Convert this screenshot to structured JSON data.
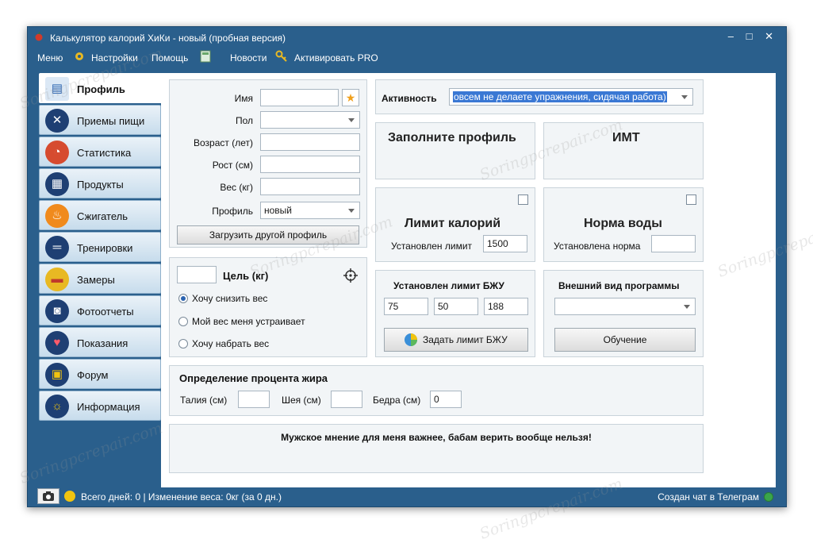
{
  "window": {
    "title": "Калькулятор калорий ХиКи - новый (пробная версия)",
    "controls": {
      "minimize": "‒",
      "maximize": "□",
      "close": "✕"
    }
  },
  "menu": {
    "menu": "Меню",
    "settings": "Настройки",
    "help": "Помощь",
    "news": "Новости",
    "activate": "Активировать PRO"
  },
  "sidebar": {
    "items": [
      {
        "label": "Профиль",
        "icon": "profile-card-icon",
        "glyph": "▤"
      },
      {
        "label": "Приемы пищи",
        "icon": "cutlery-icon",
        "glyph": "✕"
      },
      {
        "label": "Статистика",
        "icon": "pie-chart-icon",
        "glyph": "◔"
      },
      {
        "label": "Продукты",
        "icon": "grocery-bag-icon",
        "glyph": "▦"
      },
      {
        "label": "Сжигатель",
        "icon": "flame-icon",
        "glyph": "♨"
      },
      {
        "label": "Тренировки",
        "icon": "dumbbell-icon",
        "glyph": "═"
      },
      {
        "label": "Замеры",
        "icon": "tape-measure-icon",
        "glyph": "▬"
      },
      {
        "label": "Фотоотчеты",
        "icon": "camera-icon",
        "glyph": "◙"
      },
      {
        "label": "Показания",
        "icon": "heart-pulse-icon",
        "glyph": "♥"
      },
      {
        "label": "Форум",
        "icon": "chat-bubbles-icon",
        "glyph": "▣"
      },
      {
        "label": "Информация",
        "icon": "lightbulb-icon",
        "glyph": "☼"
      }
    ]
  },
  "profile": {
    "name_label": "Имя",
    "name_value": "",
    "gender_label": "Пол",
    "gender_value": "",
    "age_label": "Возраст (лет)",
    "age_value": "",
    "height_label": "Рост (см)",
    "height_value": "",
    "weight_label": "Вес (кг)",
    "weight_value": "",
    "profile_label": "Профиль",
    "profile_value": "новый",
    "load_button": "Загрузить другой профиль"
  },
  "goal": {
    "value": "",
    "label": "Цель (кг)",
    "options": [
      "Хочу снизить вес",
      "Мой вес меня устраивает",
      "Хочу набрать вес"
    ],
    "selected_index": 0
  },
  "activity": {
    "label": "Активность",
    "value": "овсем не делаете упражнения, сидячая работа)"
  },
  "cards": {
    "fill_profile": "Заполните профиль",
    "bmi": "ИМТ",
    "calorie_limit_title": "Лимит калорий",
    "calorie_limit_label": "Установлен лимит",
    "calorie_limit_value": "1500",
    "water_title": "Норма воды",
    "water_label": "Установлена норма",
    "water_value": ""
  },
  "bju": {
    "title": "Установлен лимит БЖУ",
    "protein": "75",
    "fat": "50",
    "carbs": "188",
    "button": "Задать лимит БЖУ"
  },
  "appearance": {
    "title": "Внешний вид программы",
    "value": "",
    "button": "Обучение"
  },
  "fat_percent": {
    "title": "Определение процента жира",
    "waist_label": "Талия (см)",
    "waist_value": "",
    "neck_label": "Шея (см)",
    "neck_value": "",
    "hips_label": "Бедра (см)",
    "hips_value": "0"
  },
  "quote": "Мужское мнение для меня важнее, бабам верить вообще нельзя!",
  "status": {
    "left": "Всего дней: 0  |  Изменение веса: 0кг (за 0 дн.)",
    "right": "Создан чат в Телеграм"
  },
  "watermark": "Soringpcrepair.com",
  "colors": {
    "window_frame": "#2a5f8c",
    "accent": "#2a63b0",
    "status_green": "#3aa64a"
  }
}
